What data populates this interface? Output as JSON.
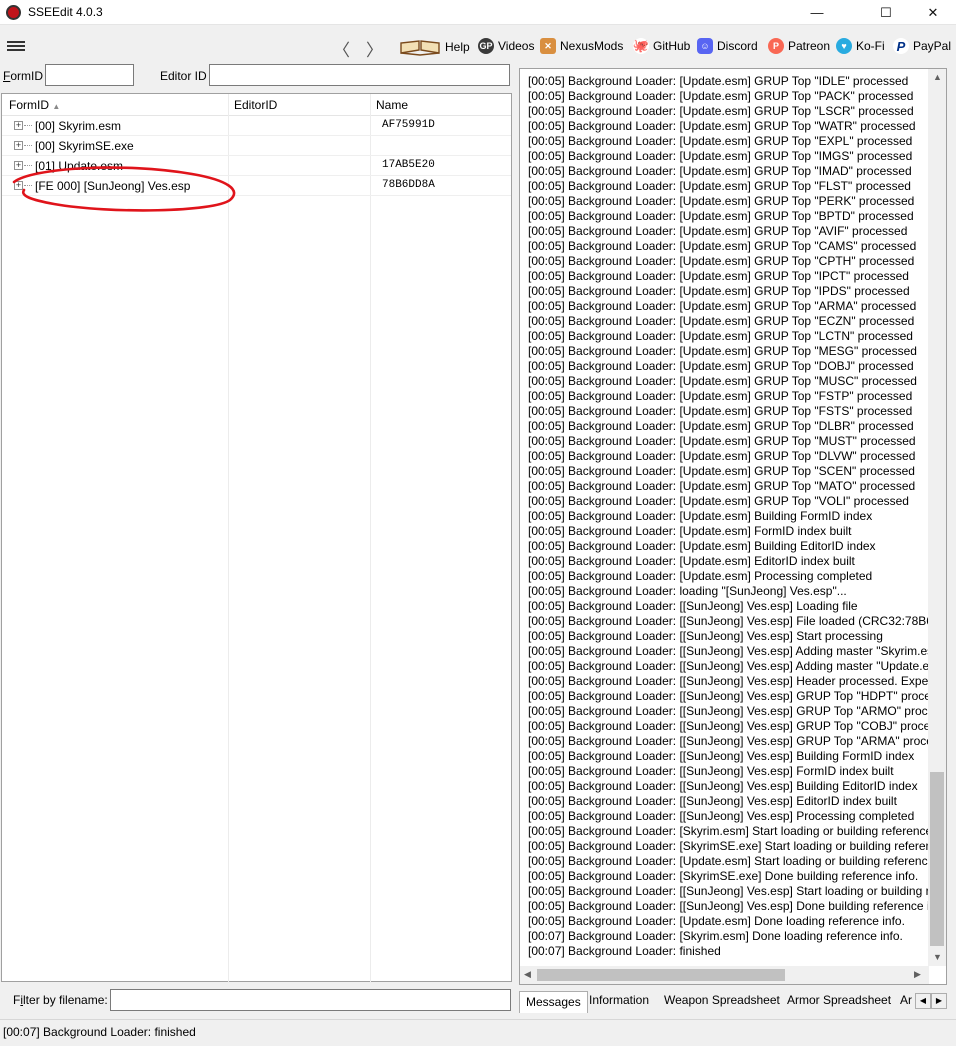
{
  "window": {
    "title": "SSEEdit 4.0.3",
    "controls": [
      "—",
      "☐",
      "✕"
    ]
  },
  "toolbar": {
    "back": "〈",
    "forward": "〉",
    "links": [
      {
        "label": "Help",
        "icon": "book-icon"
      },
      {
        "label": "Videos",
        "icon": "videos-icon"
      },
      {
        "label": "NexusMods",
        "icon": "nexusmods-icon"
      },
      {
        "label": "GitHub",
        "icon": "github-icon"
      },
      {
        "label": "Discord",
        "icon": "discord-icon"
      },
      {
        "label": "Patreon",
        "icon": "patreon-icon"
      },
      {
        "label": "Ko-Fi",
        "icon": "kofi-icon"
      },
      {
        "label": "PayPal",
        "icon": "paypal-icon"
      }
    ]
  },
  "search": {
    "formid_label_first": "F",
    "formid_label_rest": "ormID",
    "formid_value": "",
    "editorid_label": "Editor ID",
    "editorid_value": ""
  },
  "tree": {
    "columns": [
      "FormID",
      "EditorID",
      "Name"
    ],
    "sort_indicator": "▲",
    "rows": [
      {
        "name": "[00] Skyrim.esm",
        "value": "AF75991D"
      },
      {
        "name": "[00] SkyrimSE.exe",
        "value": ""
      },
      {
        "name": "[01] Update.esm",
        "value": "17AB5E20"
      },
      {
        "name": "[FE 000] [SunJeong] Ves.esp",
        "value": "78B6DD8A"
      }
    ],
    "highlight_color": "#e0141b"
  },
  "filter": {
    "label_first": "F",
    "label_i": "i",
    "label_rest": "lter by filename:",
    "value": ""
  },
  "log": {
    "lines": [
      "[00:05] Background Loader: [Update.esm] GRUP Top \"IDLE\" processed",
      "[00:05] Background Loader: [Update.esm] GRUP Top \"PACK\" processed",
      "[00:05] Background Loader: [Update.esm] GRUP Top \"LSCR\" processed",
      "[00:05] Background Loader: [Update.esm] GRUP Top \"WATR\" processed",
      "[00:05] Background Loader: [Update.esm] GRUP Top \"EXPL\" processed",
      "[00:05] Background Loader: [Update.esm] GRUP Top \"IMGS\" processed",
      "[00:05] Background Loader: [Update.esm] GRUP Top \"IMAD\" processed",
      "[00:05] Background Loader: [Update.esm] GRUP Top \"FLST\" processed",
      "[00:05] Background Loader: [Update.esm] GRUP Top \"PERK\" processed",
      "[00:05] Background Loader: [Update.esm] GRUP Top \"BPTD\" processed",
      "[00:05] Background Loader: [Update.esm] GRUP Top \"AVIF\" processed",
      "[00:05] Background Loader: [Update.esm] GRUP Top \"CAMS\" processed",
      "[00:05] Background Loader: [Update.esm] GRUP Top \"CPTH\" processed",
      "[00:05] Background Loader: [Update.esm] GRUP Top \"IPCT\" processed",
      "[00:05] Background Loader: [Update.esm] GRUP Top \"IPDS\" processed",
      "[00:05] Background Loader: [Update.esm] GRUP Top \"ARMA\" processed",
      "[00:05] Background Loader: [Update.esm] GRUP Top \"ECZN\" processed",
      "[00:05] Background Loader: [Update.esm] GRUP Top \"LCTN\" processed",
      "[00:05] Background Loader: [Update.esm] GRUP Top \"MESG\" processed",
      "[00:05] Background Loader: [Update.esm] GRUP Top \"DOBJ\" processed",
      "[00:05] Background Loader: [Update.esm] GRUP Top \"MUSC\" processed",
      "[00:05] Background Loader: [Update.esm] GRUP Top \"FSTP\" processed",
      "[00:05] Background Loader: [Update.esm] GRUP Top \"FSTS\" processed",
      "[00:05] Background Loader: [Update.esm] GRUP Top \"DLBR\" processed",
      "[00:05] Background Loader: [Update.esm] GRUP Top \"MUST\" processed",
      "[00:05] Background Loader: [Update.esm] GRUP Top \"DLVW\" processed",
      "[00:05] Background Loader: [Update.esm] GRUP Top \"SCEN\" processed",
      "[00:05] Background Loader: [Update.esm] GRUP Top \"MATO\" processed",
      "[00:05] Background Loader: [Update.esm] GRUP Top \"VOLI\" processed",
      "[00:05] Background Loader: [Update.esm] Building FormID index",
      "[00:05] Background Loader: [Update.esm] FormID index built",
      "[00:05] Background Loader: [Update.esm] Building EditorID index",
      "[00:05] Background Loader: [Update.esm] EditorID index built",
      "[00:05] Background Loader: [Update.esm] Processing completed",
      "[00:05] Background Loader: loading \"[SunJeong] Ves.esp\"...",
      "[00:05] Background Loader: [[SunJeong] Ves.esp] Loading file",
      "[00:05] Background Loader: [[SunJeong] Ves.esp] File loaded (CRC32:78B6DI",
      "[00:05] Background Loader: [[SunJeong] Ves.esp] Start processing",
      "[00:05] Background Loader: [[SunJeong] Ves.esp] Adding master \"Skyrim.es",
      "[00:05] Background Loader: [[SunJeong] Ves.esp] Adding master \"Update.es",
      "[00:05] Background Loader: [[SunJeong] Ves.esp] Header processed. Expecti",
      "[00:05] Background Loader: [[SunJeong] Ves.esp] GRUP Top \"HDPT\" process",
      "[00:05] Background Loader: [[SunJeong] Ves.esp] GRUP Top \"ARMO\" proces",
      "[00:05] Background Loader: [[SunJeong] Ves.esp] GRUP Top \"COBJ\" process",
      "[00:05] Background Loader: [[SunJeong] Ves.esp] GRUP Top \"ARMA\" proces",
      "[00:05] Background Loader: [[SunJeong] Ves.esp] Building FormID index",
      "[00:05] Background Loader: [[SunJeong] Ves.esp] FormID index built",
      "[00:05] Background Loader: [[SunJeong] Ves.esp] Building EditorID index",
      "[00:05] Background Loader: [[SunJeong] Ves.esp] EditorID index built",
      "[00:05] Background Loader: [[SunJeong] Ves.esp] Processing completed",
      "[00:05] Background Loader: [Skyrim.esm] Start loading or building reference",
      "[00:05] Background Loader: [SkyrimSE.exe] Start loading or building referen",
      "[00:05] Background Loader: [Update.esm] Start loading or building reference",
      "[00:05] Background Loader: [SkyrimSE.exe] Done building reference info.",
      "[00:05] Background Loader: [[SunJeong] Ves.esp] Start loading or building re",
      "[00:05] Background Loader: [[SunJeong] Ves.esp] Done building reference in",
      "[00:05] Background Loader: [Update.esm] Done loading reference info.",
      "[00:07] Background Loader: [Skyrim.esm] Done loading reference info.",
      "[00:07] Background Loader: finished"
    ]
  },
  "tabs": [
    "Messages",
    "Information",
    "Weapon Spreadsheet",
    "Armor Spreadsheet",
    "Ar"
  ],
  "status": "[00:07] Background Loader: finished"
}
